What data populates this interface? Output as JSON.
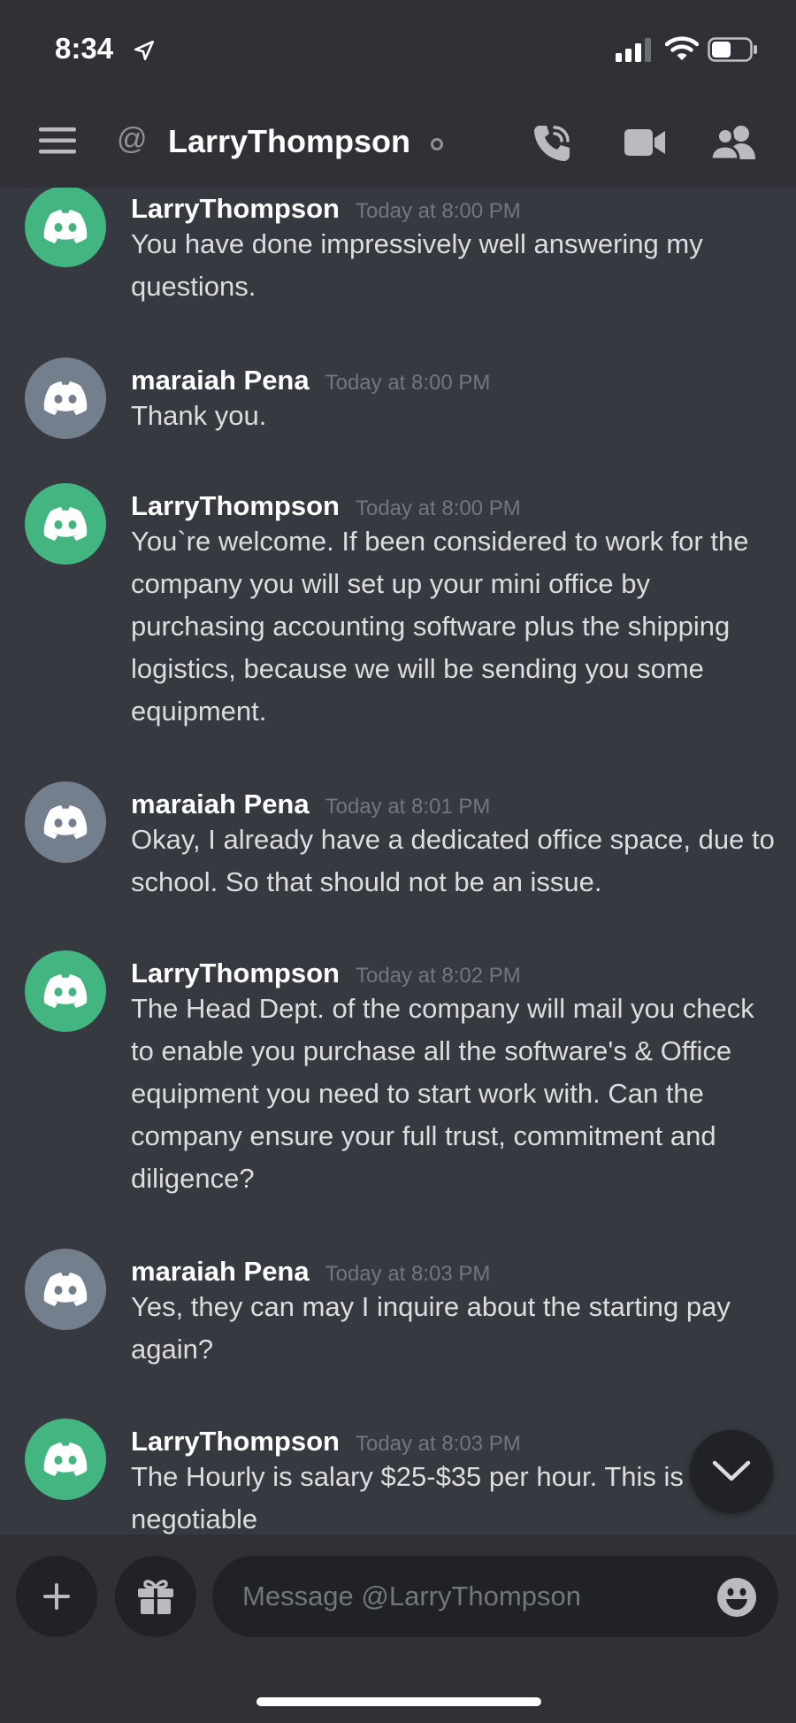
{
  "status_bar": {
    "time": "8:34"
  },
  "header": {
    "at_symbol": "@",
    "title": "LarryThompson"
  },
  "messages": [
    {
      "author": "LarryThompson",
      "timestamp": "Today at 8:00 PM",
      "text": "You have done impressively well answering my questions.",
      "avatar_color": "#43b581"
    },
    {
      "author": "maraiah Pena",
      "timestamp": "Today at 8:00 PM",
      "text": "Thank you.",
      "avatar_color": "#747f8d"
    },
    {
      "author": "LarryThompson",
      "timestamp": "Today at 8:00 PM",
      "text": "You`re welcome. If been considered to work for the company you will set up your mini office by purchasing accounting software plus the shipping logistics, because we will be sending you some equipment.",
      "avatar_color": "#43b581"
    },
    {
      "author": "maraiah Pena",
      "timestamp": "Today at 8:01 PM",
      "text": "Okay, I already have a dedicated office space, due to school. So that should not be an issue.",
      "avatar_color": "#747f8d"
    },
    {
      "author": "LarryThompson",
      "timestamp": "Today at 8:02 PM",
      "text": "The Head Dept. of the company will mail you check to enable you purchase all the software's & Office equipment you need to start work with. Can the company ensure your full trust, commitment and diligence?",
      "avatar_color": "#43b581"
    },
    {
      "author": "maraiah Pena",
      "timestamp": "Today at 8:03 PM",
      "text": "Yes, they can may I inquire about the starting pay again?",
      "avatar_color": "#747f8d"
    },
    {
      "author": "LarryThompson",
      "timestamp": "Today at 8:03 PM",
      "text": "The Hourly is salary $25-$35 per hour. This is negotiable",
      "avatar_color": "#43b581"
    }
  ],
  "composer": {
    "placeholder": "Message @LarryThompson"
  },
  "icons": {
    "menu": "hamburger-icon",
    "call": "phone-call-icon",
    "video": "video-camera-icon",
    "members": "members-icon",
    "scroll": "chevron-down-icon",
    "plus": "plus-icon",
    "gift": "gift-icon",
    "emoji": "emoji-icon",
    "avatar": "discord-logo-icon"
  },
  "colors": {
    "accent_green": "#43b581",
    "avatar_gray": "#747f8d",
    "background": "#36393f"
  }
}
